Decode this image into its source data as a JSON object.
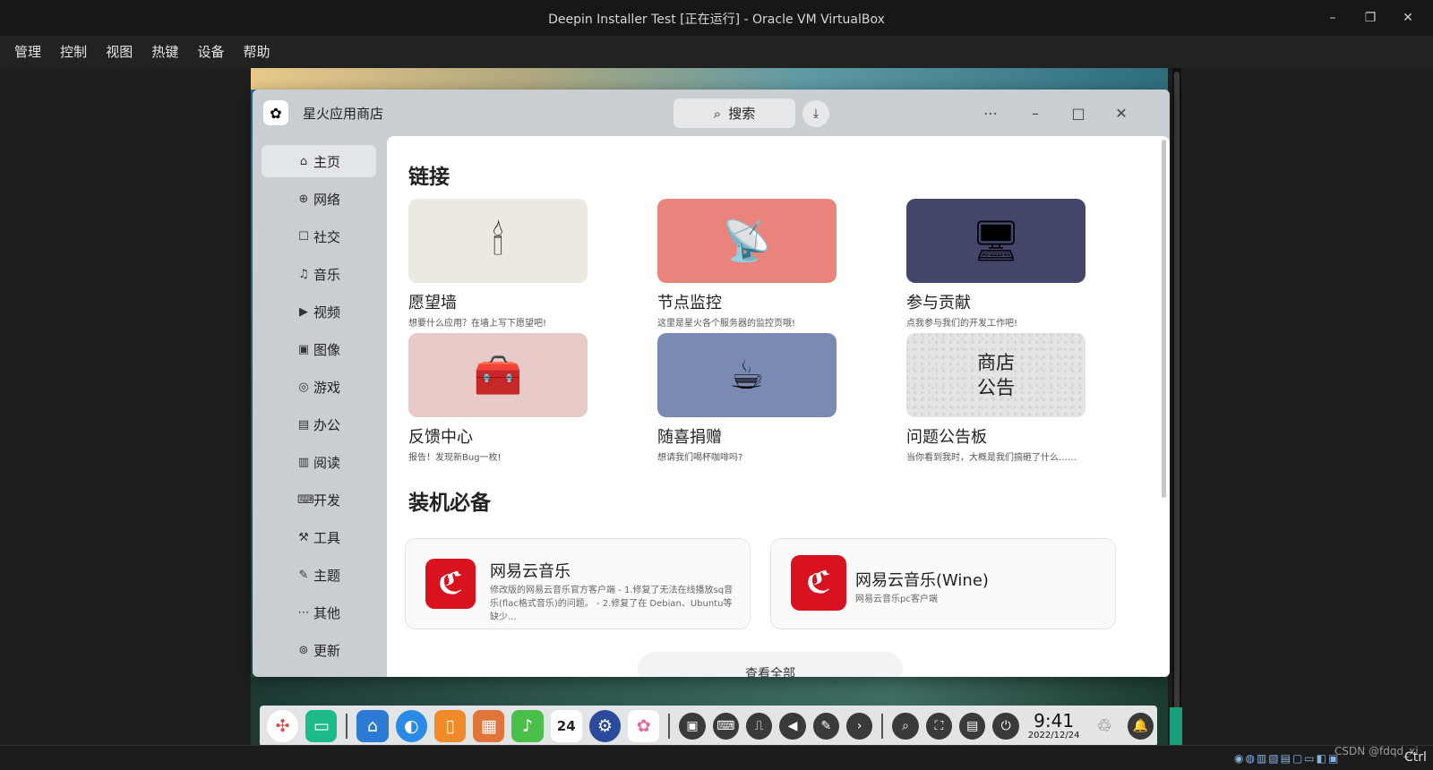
{
  "host_window": {
    "title": "Deepin Installer Test [正在运行] - Oracle VM VirtualBox",
    "controls": {
      "minimize": "–",
      "restore": "❐",
      "close": "✕"
    }
  },
  "host_menu": [
    "管理",
    "控制",
    "视图",
    "热键",
    "设备",
    "帮助"
  ],
  "app": {
    "name": "星火应用商店",
    "search_label": "搜索",
    "title_controls": {
      "more": "⋯",
      "minimize": "–",
      "maximize": "□",
      "close": "✕"
    }
  },
  "sidebar": {
    "items": [
      {
        "icon": "⌂",
        "label": "主页"
      },
      {
        "icon": "⊕",
        "label": "网络"
      },
      {
        "icon": "☐",
        "label": "社交"
      },
      {
        "icon": "♫",
        "label": "音乐"
      },
      {
        "icon": "▶",
        "label": "视频"
      },
      {
        "icon": "▣",
        "label": "图像"
      },
      {
        "icon": "◎",
        "label": "游戏"
      },
      {
        "icon": "▤",
        "label": "办公"
      },
      {
        "icon": "▥",
        "label": "阅读"
      },
      {
        "icon": "⌨",
        "label": "开发"
      },
      {
        "icon": "⚒",
        "label": "工具"
      },
      {
        "icon": "✎",
        "label": "主题"
      },
      {
        "icon": "⋯",
        "label": "其他"
      },
      {
        "icon": "⊚",
        "label": "更新"
      }
    ]
  },
  "links": {
    "title": "链接",
    "cards": [
      {
        "emoji": "🕯",
        "title": "愿望墙",
        "desc": "想要什么应用？在墙上写下愿望吧!",
        "color": "#ece8e2"
      },
      {
        "emoji": "📡",
        "title": "节点监控",
        "desc": "这里是星火各个服务器的监控页哦!",
        "color": "#e8847c"
      },
      {
        "emoji": "🖥",
        "title": "参与贡献",
        "desc": "点我参与我们的开发工作吧!",
        "color": "#44456a"
      },
      {
        "emoji": "🧰",
        "title": "反馈中心",
        "desc": "报告！发现新Bug一枚!",
        "color": "#e8cac8"
      },
      {
        "emoji": "☕",
        "title": "随喜捐赠",
        "desc": "想请我们喝杯咖啡吗?",
        "color": "#7b8ab2"
      },
      {
        "line1": "商店",
        "line2": "公告",
        "title": "问题公告板",
        "desc": "当你看到我时，大概是我们搞砸了什么……"
      }
    ]
  },
  "essentials": {
    "title": "装机必备",
    "apps": [
      {
        "icon_glyph": "ℭ",
        "name": "网易云音乐",
        "desc": "修改版的网易云音乐官方客户端 - 1.修复了无法在线播放sq音乐(flac格式音乐)的问题。 - 2.修复了在 Debian、Ubuntu等缺少..."
      },
      {
        "icon_glyph": "ℭ",
        "name": "网易云音乐(Wine)",
        "desc": "网易云音乐pc客户端"
      }
    ],
    "view_all": "查看全部"
  },
  "dock": {
    "apps": [
      "✣",
      "▭",
      "⌂",
      "◐",
      "▯",
      "▦",
      "♪",
      "24",
      "⚙",
      "✿"
    ],
    "tools": [
      "▣",
      "⌨",
      "⎍",
      "◀",
      "✎",
      "›"
    ],
    "tools_right": [
      "⌕",
      "⛶",
      "▤",
      "⏻"
    ],
    "time": "9:41",
    "date": "2022/12/24",
    "trash": "♲",
    "bell": "🔔"
  },
  "host_status": {
    "icons": "◉◍▥▧▤▢▭◧▣",
    "watermark": "CSDN @fdqd_xi",
    "host_key": "Ctrl"
  }
}
